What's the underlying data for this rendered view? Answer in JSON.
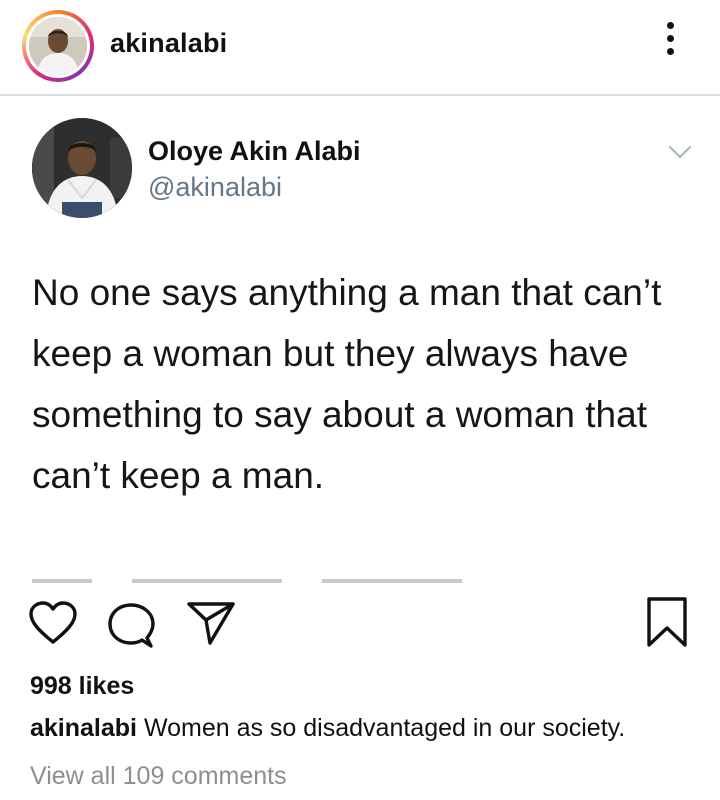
{
  "header": {
    "username": "akinalabi",
    "avatar_icon": "profile-photo",
    "more_icon": "more-vertical-icon"
  },
  "tweet": {
    "display_name": "Oloye Akin Alabi",
    "handle": "@akinalabi",
    "text": "No one says anything a man that can’t keep a woman but they always have something to say about a woman that can’t keep a man.",
    "chevron_icon": "chevron-down-icon"
  },
  "actions": {
    "like_icon": "heart-icon",
    "comment_icon": "comment-icon",
    "share_icon": "paper-plane-icon",
    "save_icon": "bookmark-icon"
  },
  "post": {
    "likes": "998 likes",
    "caption_user": "akinalabi",
    "caption_text": "Women as so disadvantaged in our society.",
    "view_comments": "View all 109 comments"
  },
  "colors": {
    "handle_gray": "#657786",
    "muted_gray": "#8e8e8e",
    "divider": "#dcdcdc",
    "text": "#111111"
  }
}
